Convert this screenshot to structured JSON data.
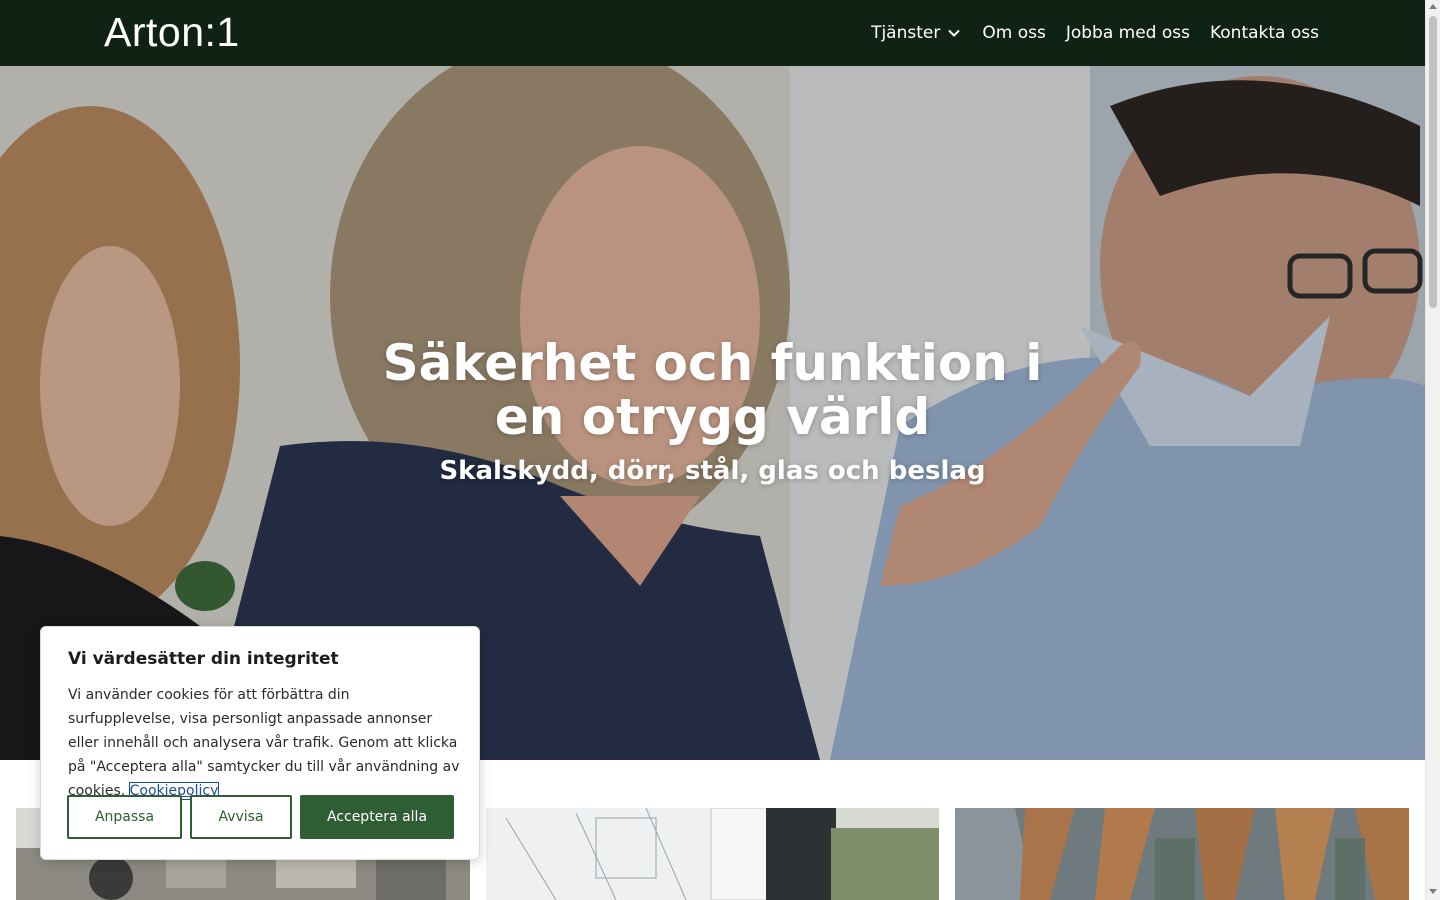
{
  "header": {
    "logo": "Arton:1",
    "nav": [
      {
        "label": "Tjänster",
        "has_dropdown": true
      },
      {
        "label": "Om oss"
      },
      {
        "label": "Jobba med oss"
      },
      {
        "label": "Kontakta oss"
      }
    ]
  },
  "hero": {
    "title_line1": "Säkerhet och funktion i",
    "title_line2": "en otrygg värld",
    "subtitle": "Skalskydd, dörr, stål, glas och beslag"
  },
  "cookie_banner": {
    "title": "Vi värdesätter din integritet",
    "text": "Vi använder cookies för att förbättra din surfupplevelse, visa personligt anpassade annonser eller innehåll och analysera vår trafik. Genom att klicka på \"Acceptera alla\" samtycker du till vår användning av cookies.",
    "policy_link": "Cookiepolicy",
    "buttons": {
      "customize": "Anpassa",
      "reject": "Avvisa",
      "accept_all": "Acceptera alla"
    }
  },
  "colors": {
    "header_bg": "#0f2214",
    "brand_green": "#2f5d34",
    "link_blue": "#1b4d9b"
  },
  "icons": {
    "dropdown": "chevron-down-icon"
  }
}
